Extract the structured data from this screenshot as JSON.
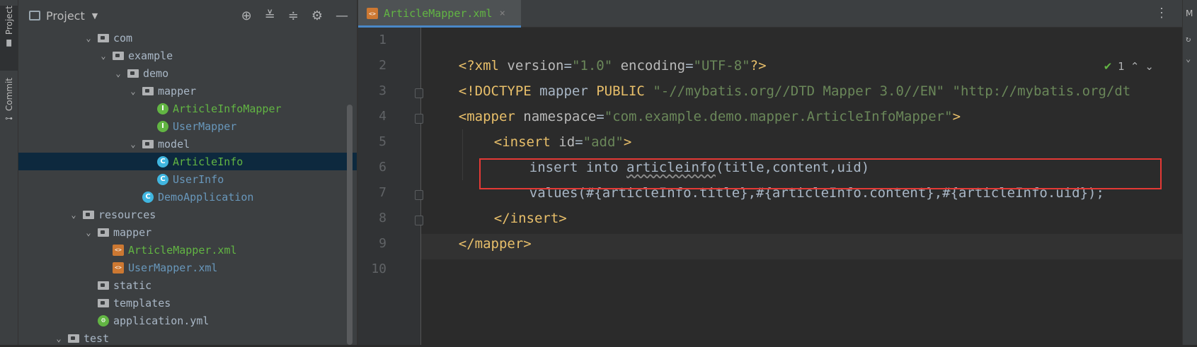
{
  "left_strip": {
    "project_tab": "Project",
    "commit_tab": "Commit"
  },
  "panel": {
    "title": "Project",
    "tree": [
      {
        "label": "com",
        "kind": "folder",
        "color": "norm"
      },
      {
        "label": "example",
        "kind": "folder",
        "color": "norm"
      },
      {
        "label": "demo",
        "kind": "folder",
        "color": "norm"
      },
      {
        "label": "mapper",
        "kind": "folder",
        "color": "norm"
      },
      {
        "label": "ArticleInfoMapper",
        "kind": "interface",
        "color": "green"
      },
      {
        "label": "UserMapper",
        "kind": "interface",
        "color": "blue"
      },
      {
        "label": "model",
        "kind": "folder",
        "color": "norm"
      },
      {
        "label": "ArticleInfo",
        "kind": "class",
        "color": "green"
      },
      {
        "label": "UserInfo",
        "kind": "class",
        "color": "blue"
      },
      {
        "label": "DemoApplication",
        "kind": "class",
        "color": "blue"
      },
      {
        "label": "resources",
        "kind": "folder",
        "color": "norm"
      },
      {
        "label": "mapper",
        "kind": "folder",
        "color": "norm"
      },
      {
        "label": "ArticleMapper.xml",
        "kind": "xml",
        "color": "green"
      },
      {
        "label": "UserMapper.xml",
        "kind": "xml",
        "color": "blue"
      },
      {
        "label": "static",
        "kind": "folder",
        "color": "norm"
      },
      {
        "label": "templates",
        "kind": "folder",
        "color": "norm"
      },
      {
        "label": "application.yml",
        "kind": "yml",
        "color": "norm"
      },
      {
        "label": "test",
        "kind": "folder",
        "color": "norm"
      }
    ]
  },
  "editor": {
    "tab_label": "ArticleMapper.xml",
    "tab_close": "×",
    "inspection_count": "1",
    "line_numbers": [
      "1",
      "2",
      "3",
      "4",
      "5",
      "6",
      "7",
      "8",
      "9",
      "10"
    ],
    "lines": {
      "l1_a": "<?xml ",
      "l1_b": "version",
      "l1_c": "=",
      "l1_d": "\"1.0\"",
      "l1_e": " encoding",
      "l1_f": "=",
      "l1_g": "\"UTF-8\"",
      "l1_h": "?>",
      "l2_a": "<!DOCTYPE ",
      "l2_b": "mapper ",
      "l2_c": "PUBLIC ",
      "l2_d": "\"-//mybatis.org//DTD Mapper 3.0//EN\" \"http://mybatis.org/dt",
      "l3_a": "<mapper ",
      "l3_b": "namespace",
      "l3_c": "=",
      "l3_d": "\"com.example.demo.mapper.ArticleInfoMapper\"",
      "l3_e": ">",
      "l4_a": "<insert ",
      "l4_b": "id",
      "l4_c": "=",
      "l4_d": "\"add\"",
      "l4_e": ">",
      "l5_a": "insert into ",
      "l5_b": "articleinfo",
      "l5_c": "(title,content,uid)",
      "l6": "values(#{articleInfo.title},#{articleInfo.content},#{articleInfo.uid});",
      "l7_a": "</",
      "l7_b": "insert",
      "l7_c": ">",
      "l8": "</mapper>"
    }
  },
  "right_strip": {
    "label": "M"
  },
  "colors": {
    "tag": "#E8BF6A",
    "string": "#6A8759",
    "highlight": "#E53935",
    "accent": "#4A88C7"
  }
}
